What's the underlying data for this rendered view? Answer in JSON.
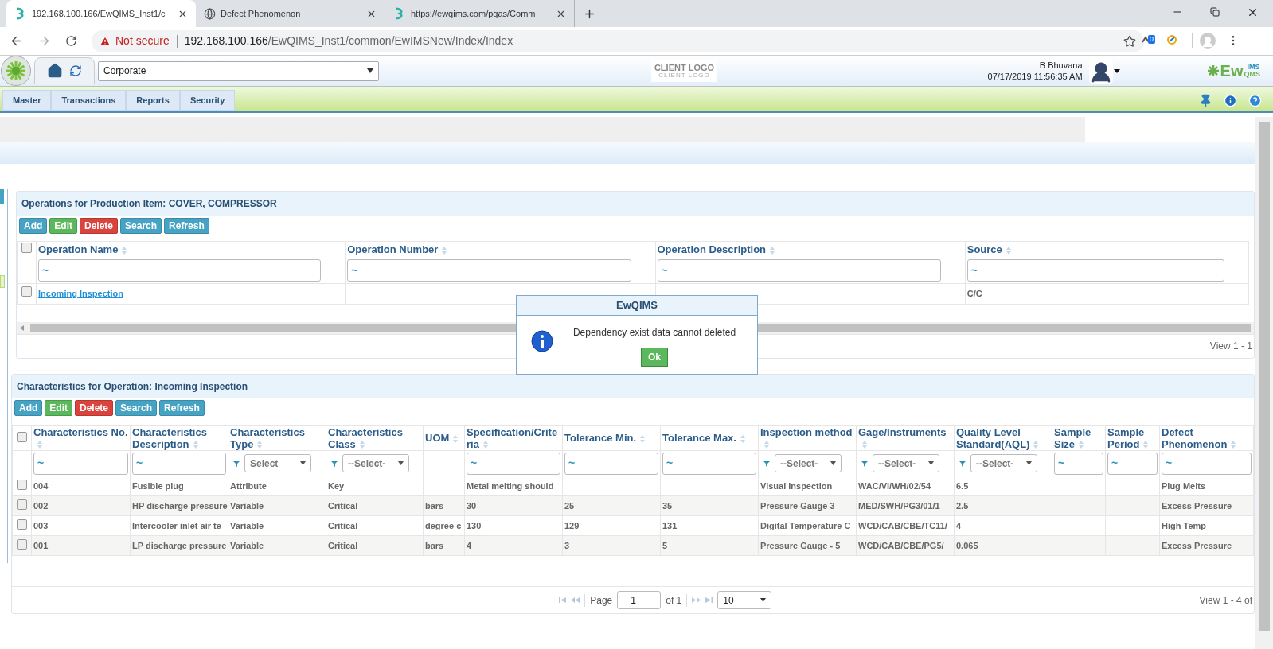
{
  "browser": {
    "tabs": [
      {
        "title": "192.168.100.166/EwQIMS_Inst1/c",
        "selected": true,
        "kind": "app"
      },
      {
        "title": "Defect Phenomenon",
        "selected": false,
        "kind": "web"
      },
      {
        "title": "https://ewqims.com/pqas/Comm",
        "selected": false,
        "kind": "app"
      }
    ],
    "security": "Not secure",
    "url_host": "192.168.100.166",
    "url_path": "/EwQIMS_Inst1/common/EwIMSNew/Index/Index",
    "extension_badge": "0"
  },
  "header": {
    "site": "Corporate",
    "client_logo": "CLIENT LOGO",
    "client_logo_sub": "CLIENT LOGO",
    "user": "B Bhuvana",
    "datetime": "07/17/2019 11:56:35 AM",
    "brand": "Ew",
    "brand_top": "IMS",
    "brand_bottom": "QMS"
  },
  "menu": [
    "Master",
    "Transactions",
    "Reports",
    "Security"
  ],
  "operations": {
    "title": "Operations for Production Item: COVER, COMPRESSOR",
    "buttons": [
      {
        "label": "Add",
        "kind": "add"
      },
      {
        "label": "Edit",
        "kind": "edit"
      },
      {
        "label": "Delete",
        "kind": "delete"
      },
      {
        "label": "Search",
        "kind": "search"
      },
      {
        "label": "Refresh",
        "kind": "refresh"
      }
    ],
    "select_all": false,
    "columns": [
      {
        "label": "Operation Name",
        "filter": "~"
      },
      {
        "label": "Operation Number",
        "filter": "~"
      },
      {
        "label": "Operation Description",
        "filter": "~"
      },
      {
        "label": "Source",
        "filter": "~"
      }
    ],
    "rows": [
      {
        "checked": false,
        "cells": [
          "Incoming Inspection",
          null,
          null,
          "C/C"
        ]
      }
    ],
    "view": "View 1 - 1"
  },
  "characteristics": {
    "title": "Characteristics for Operation: Incoming Inspection",
    "buttons": [
      {
        "label": "Add",
        "kind": "add"
      },
      {
        "label": "Edit",
        "kind": "edit"
      },
      {
        "label": "Delete",
        "kind": "delete"
      },
      {
        "label": "Search",
        "kind": "search"
      },
      {
        "label": "Refresh",
        "kind": "refresh"
      }
    ],
    "select_all": false,
    "columns": [
      {
        "label": "Characteristics No.",
        "filter": {
          "kind": "text",
          "value": "~"
        }
      },
      {
        "label": "Characteristics Description",
        "filter": {
          "kind": "text",
          "value": "~"
        }
      },
      {
        "label": "Characteristics Type",
        "filter": {
          "kind": "select",
          "value": "Select"
        }
      },
      {
        "label": "Characteristics Class",
        "filter": {
          "kind": "select",
          "value": "--Select-"
        }
      },
      {
        "label": "UOM"
      },
      {
        "label": "Specification/Criteria",
        "filter": {
          "kind": "text",
          "value": "~"
        }
      },
      {
        "label": "Tolerance Min.",
        "filter": {
          "kind": "text",
          "value": "~"
        }
      },
      {
        "label": "Tolerance Max.",
        "filter": {
          "kind": "text",
          "value": "~"
        }
      },
      {
        "label": "Inspection method",
        "filter": {
          "kind": "select",
          "value": "--Select-"
        }
      },
      {
        "label": "Gage/Instruments",
        "filter": {
          "kind": "select",
          "value": "--Select-"
        }
      },
      {
        "label": "Quality Level Standard(AQL)",
        "filter": {
          "kind": "select",
          "value": "--Select-"
        }
      },
      {
        "label": "Sample Size",
        "filter": {
          "kind": "text",
          "value": "~"
        }
      },
      {
        "label": "Sample Period",
        "filter": {
          "kind": "text",
          "value": "~"
        }
      },
      {
        "label": "Defect Phenomenon",
        "filter": {
          "kind": "text",
          "value": "~"
        }
      }
    ],
    "rows": [
      {
        "checked": false,
        "cells": [
          "004",
          "Fusible plug",
          "Attribute",
          "Key",
          null,
          "Metal melting should",
          null,
          null,
          "Visual Inspection",
          "WAC/VI/WH/02/54",
          "6.5",
          null,
          null,
          "Plug Melts"
        ]
      },
      {
        "checked": false,
        "cells": [
          "002",
          "HP discharge pressure",
          "Variable",
          "Critical",
          "bars",
          "30",
          "25",
          "35",
          "Pressure Gauge 3",
          "MED/SWH/PG3/01/1",
          "2.5",
          null,
          null,
          "Excess Pressure"
        ]
      },
      {
        "checked": false,
        "cells": [
          "003",
          "Intercooler inlet air te",
          "Variable",
          "Critical",
          "degree c",
          "130",
          "129",
          "131",
          "Digital Temperature C",
          "WCD/CAB/CBE/TC11/",
          "4",
          null,
          null,
          "High Temp"
        ]
      },
      {
        "checked": false,
        "cells": [
          "001",
          "LP discharge pressure",
          "Variable",
          "Critical",
          "bars",
          "4",
          "3",
          "5",
          "Pressure Gauge - 5",
          "WCD/CAB/CBE/PG5/",
          "0.065",
          null,
          null,
          "Excess Pressure"
        ]
      }
    ],
    "pager": {
      "page_label": "Page",
      "page": "1",
      "of": "of 1",
      "page_size": "10",
      "view": "View 1 - 4 of"
    }
  },
  "dialog": {
    "title": "EwQIMS",
    "message": "Dependency exist data cannot deleted",
    "button": "Ok"
  }
}
